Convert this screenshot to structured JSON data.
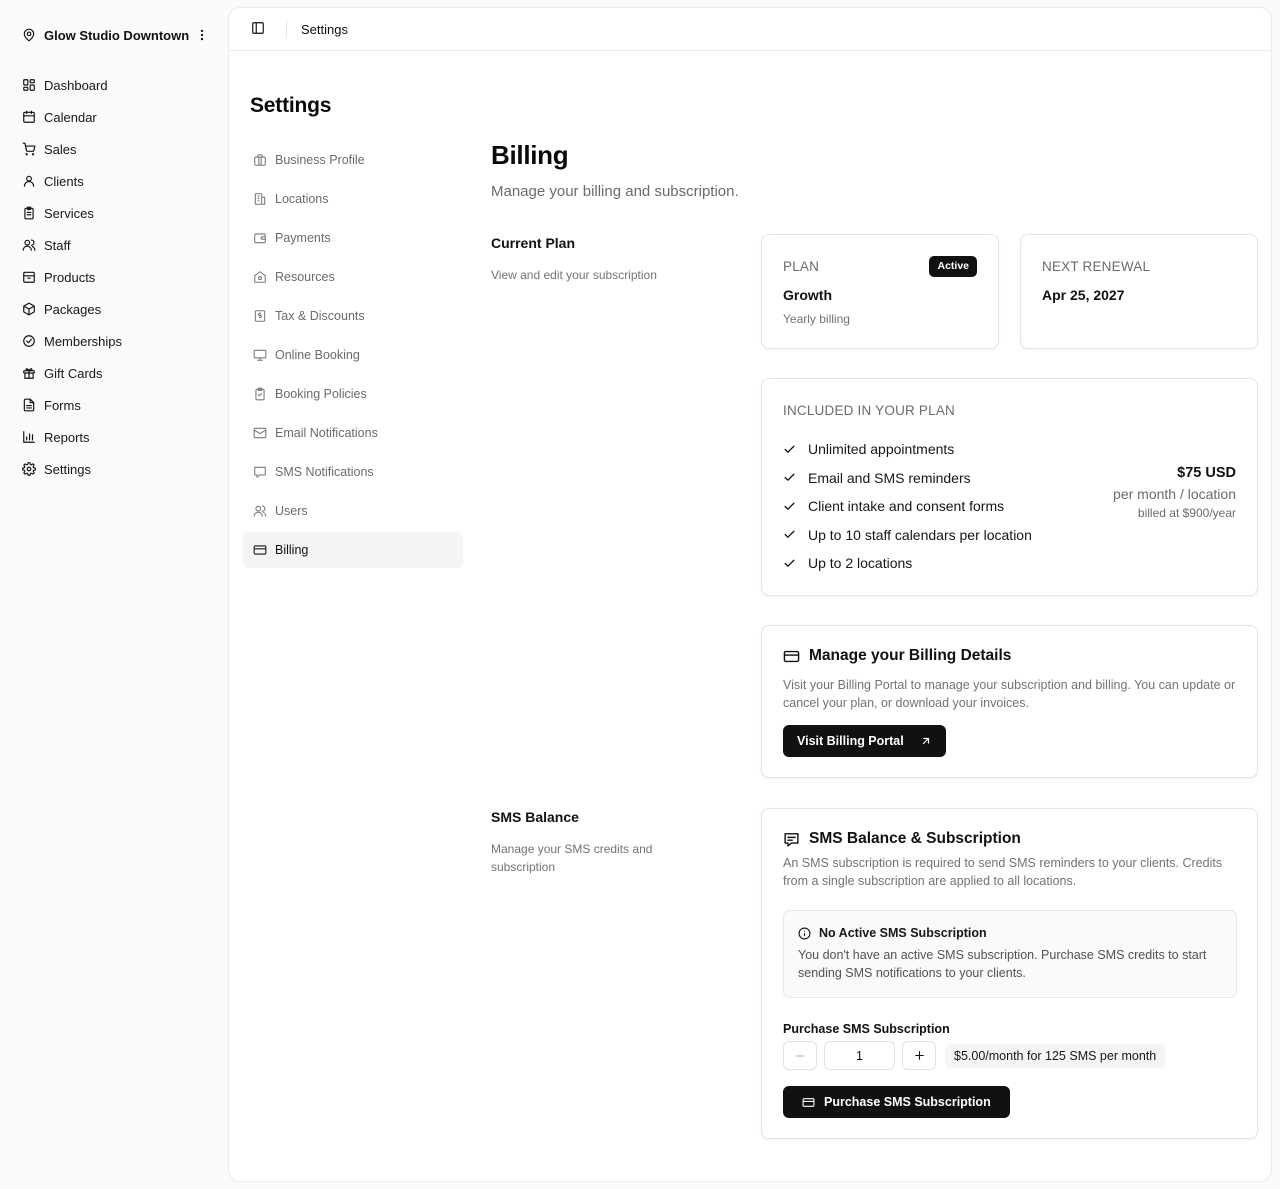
{
  "location": {
    "name": "Glow Studio Downtown"
  },
  "nav": [
    {
      "label": "Dashboard",
      "icon": "dashboard-icon"
    },
    {
      "label": "Calendar",
      "icon": "calendar-icon"
    },
    {
      "label": "Sales",
      "icon": "cart-icon"
    },
    {
      "label": "Clients",
      "icon": "user-icon"
    },
    {
      "label": "Services",
      "icon": "clipboard-icon"
    },
    {
      "label": "Staff",
      "icon": "users-icon"
    },
    {
      "label": "Products",
      "icon": "archive-icon"
    },
    {
      "label": "Packages",
      "icon": "package-icon"
    },
    {
      "label": "Memberships",
      "icon": "badge-check-icon"
    },
    {
      "label": "Gift Cards",
      "icon": "gift-icon"
    },
    {
      "label": "Forms",
      "icon": "file-text-icon"
    },
    {
      "label": "Reports",
      "icon": "bar-chart-icon"
    },
    {
      "label": "Settings",
      "icon": "gear-icon"
    }
  ],
  "topbar": {
    "breadcrumb": "Settings"
  },
  "settings": {
    "title": "Settings",
    "items": [
      {
        "label": "Business Profile",
        "icon": "briefcase-icon"
      },
      {
        "label": "Locations",
        "icon": "building-icon"
      },
      {
        "label": "Payments",
        "icon": "wallet-icon"
      },
      {
        "label": "Resources",
        "icon": "house-icon"
      },
      {
        "label": "Tax & Discounts",
        "icon": "receipt-icon"
      },
      {
        "label": "Online Booking",
        "icon": "monitor-icon"
      },
      {
        "label": "Booking Policies",
        "icon": "clipboard-check-icon"
      },
      {
        "label": "Email Notifications",
        "icon": "mail-icon"
      },
      {
        "label": "SMS Notifications",
        "icon": "message-icon"
      },
      {
        "label": "Users",
        "icon": "users-icon"
      },
      {
        "label": "Billing",
        "icon": "credit-card-icon"
      }
    ],
    "active_index": 10
  },
  "billing": {
    "title": "Billing",
    "subtitle": "Manage your billing and subscription.",
    "current_plan": {
      "title": "Current Plan",
      "desc": "View and edit your subscription",
      "plan_caption": "PLAN",
      "status": "Active",
      "plan_name": "Growth",
      "plan_cycle": "Yearly billing",
      "renewal_caption": "NEXT RENEWAL",
      "renewal_date": "Apr 25, 2027"
    },
    "included": {
      "caption": "INCLUDED IN YOUR PLAN",
      "features": [
        "Unlimited appointments",
        "Email and SMS reminders",
        "Client intake and consent forms",
        "Up to 10 staff calendars per location",
        "Up to 2 locations"
      ],
      "price": "$75 USD",
      "price_per": "per month / location",
      "billed": "billed at $900/year"
    },
    "portal": {
      "title": "Manage your Billing Details",
      "desc": "Visit your Billing Portal to manage your subscription and billing. You can update or cancel your plan, or download your invoices.",
      "button": "Visit Billing Portal"
    }
  },
  "sms": {
    "section_title": "SMS Balance",
    "section_desc": "Manage your SMS credits and subscription",
    "card_title": "SMS Balance & Subscription",
    "card_desc": "An SMS subscription is required to send SMS reminders to your clients. Credits from a single subscription are applied to all locations.",
    "notice_title": "No Active SMS Subscription",
    "notice_desc": "You don't have an active SMS subscription. Purchase SMS credits to start sending SMS notifications to your clients.",
    "purchase_label": "Purchase SMS Subscription",
    "quantity": "1",
    "rate": "$5.00/month for 125 SMS per month",
    "purchase_button": "Purchase SMS Subscription"
  }
}
